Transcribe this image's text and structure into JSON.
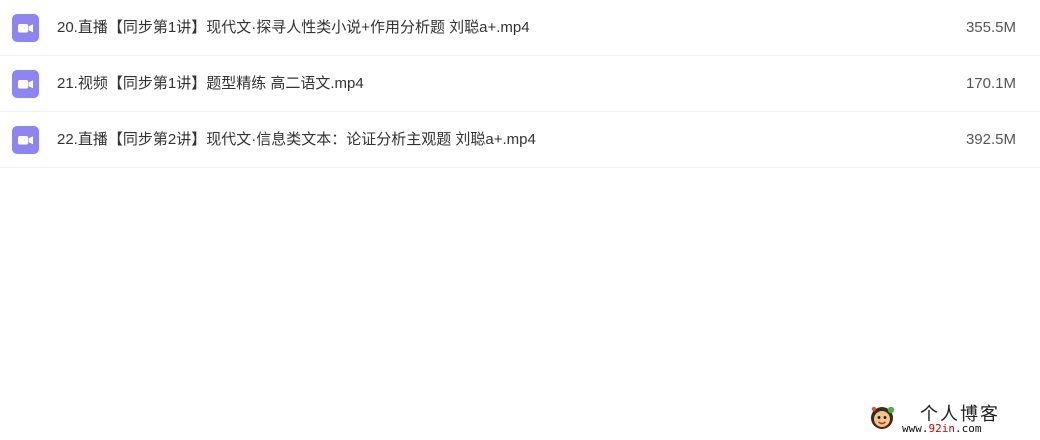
{
  "files": [
    {
      "name": "20.直播【同步第1讲】现代文·探寻人性类小说+作用分析题 刘聪a+.mp4",
      "size": "355.5M",
      "icon": "video-file-icon"
    },
    {
      "name": "21.视频【同步第1讲】题型精练 高二语文.mp4",
      "size": "170.1M",
      "icon": "video-file-icon"
    },
    {
      "name": "22.直播【同步第2讲】现代文·信息类文本：论证分析主观题 刘聪a+.mp4",
      "size": "392.5M",
      "icon": "video-file-icon"
    }
  ],
  "watermark": {
    "title": "个人博客",
    "url_prefix": "www.",
    "url_highlight": "92in",
    "url_suffix": ".com",
    "icon": "mascot-logo-icon"
  },
  "colors": {
    "icon_purple": "#8f85f2",
    "divider": "#f1f1f1",
    "text": "#333333",
    "url_highlight": "#d40000"
  }
}
